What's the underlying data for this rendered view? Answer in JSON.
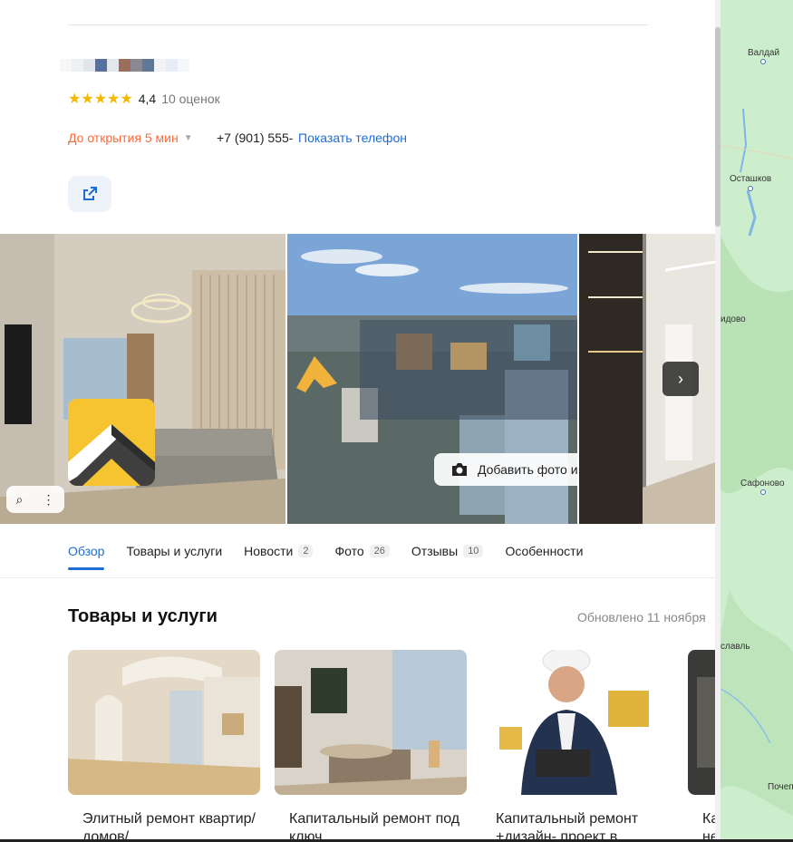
{
  "org": {
    "rating_value": "4,4",
    "rating_count": "10 оценок",
    "stars": "★★★★★",
    "hours_status": "До открытия 5 мин",
    "phone": "+7 (901) 555-",
    "show_phone_label": "Показать телефон"
  },
  "gallery": {
    "add_photo_label": "Добавить фото или видео",
    "next_label": "›"
  },
  "tabs": [
    {
      "label": "Обзор",
      "count": ""
    },
    {
      "label": "Товары и услуги",
      "count": ""
    },
    {
      "label": "Новости",
      "count": "2"
    },
    {
      "label": "Фото",
      "count": "26"
    },
    {
      "label": "Отзывы",
      "count": "10"
    },
    {
      "label": "Особенности",
      "count": ""
    }
  ],
  "section": {
    "title": "Товары и услуги",
    "updated": "Обновлено 11 ноября"
  },
  "cards": [
    {
      "title": "Элитный ремонт квартир/домов/"
    },
    {
      "title": "Капитальный ремонт под ключ"
    },
    {
      "title": "Капитальный ремонт +дизайн- проект в"
    },
    {
      "title": "Ка не"
    }
  ],
  "map": {
    "labels": [
      "Валдай",
      "Осташков",
      "идово",
      "Сафоново",
      "славль",
      "Почеп"
    ]
  },
  "colors": {
    "accent": "#1e6dd5",
    "hours": "#ff6a3c",
    "stars": "#f5b800",
    "map": "#cdeecd"
  }
}
